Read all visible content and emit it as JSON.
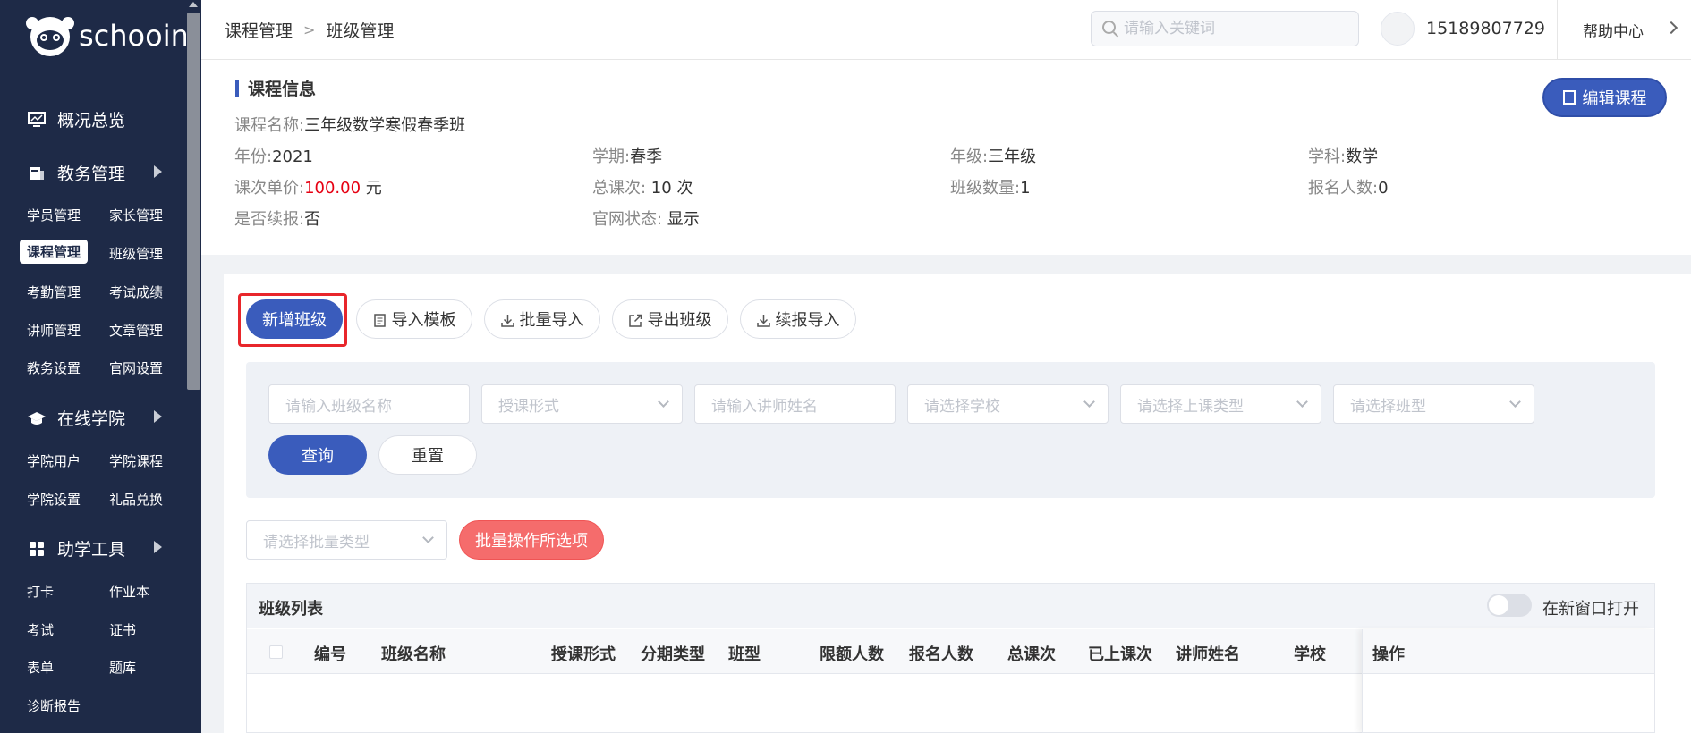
{
  "app": {
    "logo_text": "schooin"
  },
  "sidebar": {
    "groups": [
      {
        "label": "概况总览",
        "icon": "monitor-icon"
      },
      {
        "label": "教务管理",
        "icon": "book-icon"
      },
      {
        "label": "在线学院",
        "icon": "graduation-cap-icon"
      },
      {
        "label": "助学工具",
        "icon": "grid-icon"
      }
    ],
    "items": [
      "学员管理",
      "家长管理",
      "课程管理",
      "班级管理",
      "考勤管理",
      "考试成绩",
      "讲师管理",
      "文章管理",
      "教务设置",
      "官网设置",
      "学院用户",
      "学院课程",
      "学院设置",
      "礼品兑换",
      "打卡",
      "作业本",
      "考试",
      "证书",
      "表单",
      "题库",
      "诊断报告"
    ],
    "active_item": "课程管理"
  },
  "header": {
    "breadcrumb": [
      "课程管理",
      "班级管理"
    ],
    "search_placeholder": "请输入关键词",
    "phone": "15189807729",
    "help": "帮助中心"
  },
  "course_info": {
    "title": "课程信息",
    "edit_button": "编辑课程",
    "name_label": "课程名称:",
    "name_value": "三年级数学寒假春季班",
    "year_label": "年份:",
    "year_value": "2021",
    "term_label": "学期:",
    "term_value": "春季",
    "grade_label": "年级:",
    "grade_value": "三年级",
    "subject_label": "学科:",
    "subject_value": "数学",
    "price_label": "课次单价:",
    "price_value": "100.00",
    "price_unit": " 元",
    "total_lessons_label": "总课次:",
    "total_lessons_value": " 10 次",
    "class_count_label": "班级数量:",
    "class_count_value": "1",
    "enroll_label": "报名人数:",
    "enroll_value": "0",
    "renew_label": "是否续报:",
    "renew_value": "否",
    "site_status_label": "官网状态:",
    "site_status_value": " 显示"
  },
  "toolbar": {
    "add_class": "新增班级",
    "import_template": "导入模板",
    "batch_import": "批量导入",
    "export_class": "导出班级",
    "renew_import": "续报导入"
  },
  "filters": {
    "class_name": "请输入班级名称",
    "teach_form": "授课形式",
    "teacher_name": "请输入讲师姓名",
    "school": "请选择学校",
    "lesson_type": "请选择上课类型",
    "class_type": "请选择班型",
    "query": "查询",
    "reset": "重置"
  },
  "batch": {
    "type_placeholder": "请选择批量类型",
    "apply": "批量操作所选项"
  },
  "table": {
    "title": "班级列表",
    "new_window_label": "在新窗口打开",
    "new_window_on": false,
    "columns": [
      "编号",
      "班级名称",
      "授课形式",
      "分期类型",
      "班型",
      "限额人数",
      "报名人数",
      "总课次",
      "已上课次",
      "讲师姓名",
      "学校",
      "操作"
    ]
  }
}
